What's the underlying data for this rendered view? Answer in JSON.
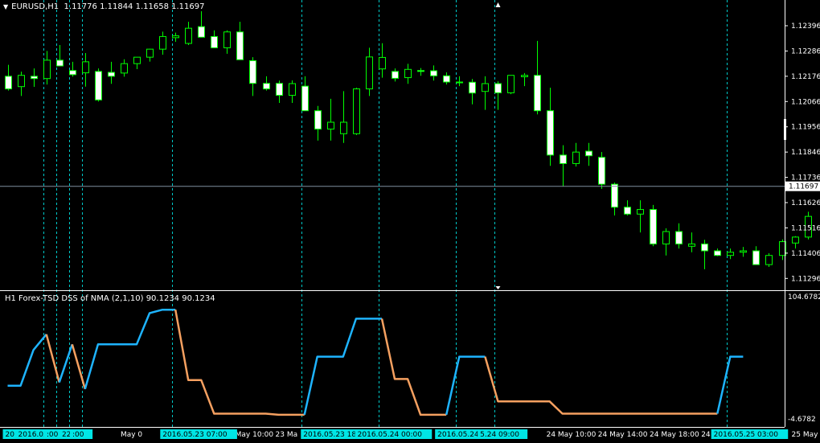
{
  "header": {
    "symbol": "EURUSD,H1",
    "ohlc": "1.11776 1.11844 1.11658 1.11697"
  },
  "indicator": {
    "label": "H1 Forex-TSD DSS of NMA (2,1,10) 90.1234 90.1234"
  },
  "colors": {
    "background": "#000000",
    "bull_candle": "#00ff00",
    "bear_body": "#ffffff",
    "dss_up": "#1eb4ff",
    "dss_down": "#f5a060",
    "vline": "#00c8c8",
    "label_box": "#00e5e5",
    "axis": "#ffffff"
  },
  "price_axis": {
    "ticks": [
      "1.12396",
      "1.12286",
      "1.12176",
      "1.12066",
      "1.11956",
      "1.11846",
      "1.11736",
      "1.11626",
      "1.11516",
      "1.11406",
      "1.11296"
    ],
    "current_price": "1.11697"
  },
  "indicator_axis": {
    "max": "104.6782",
    "min": "-4.6782"
  },
  "time_axis": {
    "plain_labels": [
      {
        "text": "20",
        "align_index": 0
      },
      {
        "text": "May 0",
        "align_index": 9
      },
      {
        "text": "23 May 10:00",
        "align_index": 17
      },
      {
        "text": "23 Ma",
        "align_index": 21
      },
      {
        "text": "3:00",
        "align_index": 27
      },
      {
        "text": "24 May 10:00",
        "align_index": 42
      },
      {
        "text": "24 May 14:00",
        "align_index": 46
      },
      {
        "text": "24 May 18:00",
        "align_index": 50
      },
      {
        "text": "24 May 2",
        "align_index": 54
      },
      {
        "text": "25 May 06:00",
        "align_index": 61
      }
    ],
    "highlight_labels": [
      "20",
      "2016.05.20 22:00",
      ":00",
      ":00",
      "2016.05.23 07:00",
      "2016.05.23 18:00",
      "2016.05.24 00:00",
      "2016.05.24 06:00",
      "5.24 09:00",
      "2016.05.25 03:00"
    ]
  },
  "chart_data": {
    "type": "candlestick",
    "series_label": "EURUSD,H1",
    "y_range": [
      1.11262,
      1.12452
    ],
    "candles": [
      [
        1.12176,
        1.12226,
        1.12114,
        1.12121
      ],
      [
        1.12131,
        1.12196,
        1.1209,
        1.1218
      ],
      [
        1.12176,
        1.1221,
        1.1213,
        1.12166
      ],
      [
        1.12166,
        1.12286,
        1.1214,
        1.12246
      ],
      [
        1.12246,
        1.12312,
        1.1222,
        1.12221
      ],
      [
        1.12201,
        1.12239,
        1.12174,
        1.12183
      ],
      [
        1.12191,
        1.12277,
        1.12131,
        1.12239
      ],
      [
        1.12197,
        1.1221,
        1.12066,
        1.12073
      ],
      [
        1.12193,
        1.12239,
        1.12143,
        1.12176
      ],
      [
        1.1219,
        1.1225,
        1.12174,
        1.12231
      ],
      [
        1.12231,
        1.12256,
        1.12207,
        1.12259
      ],
      [
        1.12259,
        1.12296,
        1.1224,
        1.12294
      ],
      [
        1.12294,
        1.1237,
        1.1227,
        1.12349
      ],
      [
        1.12344,
        1.12366,
        1.12326,
        1.12352
      ],
      [
        1.12319,
        1.12413,
        1.12312,
        1.12385
      ],
      [
        1.12392,
        1.12459,
        1.12347,
        1.12346
      ],
      [
        1.12349,
        1.12376,
        1.1231,
        1.123
      ],
      [
        1.123,
        1.12376,
        1.12274,
        1.12369
      ],
      [
        1.12369,
        1.12413,
        1.1226,
        1.12248
      ],
      [
        1.12244,
        1.12259,
        1.1209,
        1.12145
      ],
      [
        1.12145,
        1.12176,
        1.12114,
        1.12121
      ],
      [
        1.12145,
        1.12157,
        1.1206,
        1.12093
      ],
      [
        1.12093,
        1.12158,
        1.1206,
        1.12144
      ],
      [
        1.12133,
        1.12176,
        1.1203,
        1.12026
      ],
      [
        1.12026,
        1.12047,
        1.11896,
        1.11946
      ],
      [
        1.11946,
        1.12078,
        1.11896,
        1.11976
      ],
      [
        1.11926,
        1.12111,
        1.11886,
        1.11976
      ],
      [
        1.11926,
        1.12126,
        1.1192,
        1.12121
      ],
      [
        1.12121,
        1.123,
        1.1209,
        1.1226
      ],
      [
        1.12208,
        1.1232,
        1.1217,
        1.12258
      ],
      [
        1.12197,
        1.1221,
        1.12153,
        1.12167
      ],
      [
        1.1217,
        1.1223,
        1.12143,
        1.12206
      ],
      [
        1.12201,
        1.12212,
        1.12178,
        1.12197
      ],
      [
        1.122,
        1.12223,
        1.12157,
        1.12178
      ],
      [
        1.12178,
        1.12193,
        1.1214,
        1.12151
      ],
      [
        1.12151,
        1.12176,
        1.12133,
        1.12149
      ],
      [
        1.1215,
        1.12164,
        1.12054,
        1.12103
      ],
      [
        1.1211,
        1.12176,
        1.1203,
        1.12144
      ],
      [
        1.12144,
        1.12154,
        1.1203,
        1.12104
      ],
      [
        1.12104,
        1.12176,
        1.12098,
        1.1218
      ],
      [
        1.12174,
        1.1219,
        1.12133,
        1.1218
      ],
      [
        1.1218,
        1.1233,
        1.1201,
        1.12026
      ],
      [
        1.12026,
        1.12126,
        1.11786,
        1.11833
      ],
      [
        1.11833,
        1.11876,
        1.11696,
        1.11796
      ],
      [
        1.11796,
        1.11886,
        1.11783,
        1.11846
      ],
      [
        1.1185,
        1.11886,
        1.11786,
        1.1183
      ],
      [
        1.11823,
        1.11846,
        1.11686,
        1.11706
      ],
      [
        1.11706,
        1.11713,
        1.1157,
        1.11606
      ],
      [
        1.11606,
        1.11636,
        1.1157,
        1.11576
      ],
      [
        1.11576,
        1.11636,
        1.11496,
        1.11596
      ],
      [
        1.11596,
        1.11616,
        1.11436,
        1.11446
      ],
      [
        1.11446,
        1.11514,
        1.11396,
        1.115
      ],
      [
        1.115,
        1.11536,
        1.11426,
        1.11446
      ],
      [
        1.11436,
        1.11496,
        1.1141,
        1.11446
      ],
      [
        1.11446,
        1.11464,
        1.11336,
        1.11416
      ],
      [
        1.11416,
        1.11426,
        1.11393,
        1.11396
      ],
      [
        1.11396,
        1.11426,
        1.1138,
        1.1141
      ],
      [
        1.1141,
        1.11433,
        1.1139,
        1.11416
      ],
      [
        1.11416,
        1.11436,
        1.11356,
        1.11356
      ],
      [
        1.11356,
        1.11406,
        1.11346,
        1.11396
      ],
      [
        1.11396,
        1.11466,
        1.11376,
        1.11456
      ],
      [
        1.1145,
        1.1148,
        1.11426,
        1.11476
      ],
      [
        1.11476,
        1.11586,
        1.11466,
        1.11566
      ]
    ],
    "indicator": {
      "name": "Forex-TSD DSS of NMA (2,1,10)",
      "y_range": [
        -4.6782,
        104.6782
      ],
      "segments": [
        {
          "color": "up",
          "points": [
            [
              0,
              25
            ],
            [
              1,
              25
            ],
            [
              2,
              57
            ],
            [
              3,
              71
            ]
          ]
        },
        {
          "color": "down",
          "points": [
            [
              3,
              71
            ],
            [
              4,
              28
            ]
          ]
        },
        {
          "color": "up",
          "points": [
            [
              4,
              28
            ],
            [
              5,
              62
            ]
          ]
        },
        {
          "color": "down",
          "points": [
            [
              5,
              62
            ],
            [
              6,
              22
            ]
          ]
        },
        {
          "color": "up",
          "points": [
            [
              6,
              22
            ],
            [
              7,
              62
            ],
            [
              8,
              62
            ],
            [
              9,
              62
            ],
            [
              10,
              62
            ],
            [
              11,
              90
            ],
            [
              12,
              93
            ],
            [
              13,
              93
            ]
          ]
        },
        {
          "color": "down",
          "points": [
            [
              13,
              93
            ],
            [
              14,
              30
            ],
            [
              15,
              30
            ],
            [
              16,
              0
            ],
            [
              17,
              0
            ],
            [
              18,
              0
            ],
            [
              19,
              0
            ],
            [
              20,
              0
            ],
            [
              21,
              -1
            ],
            [
              22,
              -1
            ],
            [
              23,
              -1
            ]
          ]
        },
        {
          "color": "up",
          "points": [
            [
              23,
              -1
            ],
            [
              24,
              51
            ],
            [
              25,
              51
            ],
            [
              26,
              51
            ],
            [
              27,
              85
            ],
            [
              28,
              85
            ],
            [
              29,
              85
            ]
          ]
        },
        {
          "color": "down",
          "points": [
            [
              29,
              85
            ],
            [
              30,
              31
            ],
            [
              31,
              31
            ],
            [
              32,
              -1
            ],
            [
              33,
              -1
            ],
            [
              34,
              -1
            ]
          ]
        },
        {
          "color": "up",
          "points": [
            [
              34,
              -1
            ],
            [
              35,
              51
            ],
            [
              36,
              51
            ],
            [
              37,
              51
            ]
          ]
        },
        {
          "color": "down",
          "points": [
            [
              37,
              51
            ],
            [
              38,
              11
            ],
            [
              39,
              11
            ],
            [
              40,
              11
            ],
            [
              41,
              11
            ],
            [
              42,
              11
            ],
            [
              43,
              0
            ],
            [
              44,
              0
            ],
            [
              45,
              0
            ],
            [
              46,
              0
            ],
            [
              47,
              0
            ],
            [
              48,
              0
            ],
            [
              49,
              0
            ],
            [
              50,
              0
            ],
            [
              51,
              0
            ],
            [
              52,
              0
            ],
            [
              53,
              0
            ],
            [
              54,
              0
            ],
            [
              55,
              0
            ]
          ]
        },
        {
          "color": "up",
          "points": [
            [
              55,
              0
            ],
            [
              56,
              51
            ],
            [
              57,
              51
            ]
          ]
        }
      ]
    },
    "vertical_markers": [
      3.0,
      4.0,
      5.0,
      6.0,
      13.0,
      23.0,
      29.0,
      35.0,
      38.0,
      56.0
    ]
  }
}
